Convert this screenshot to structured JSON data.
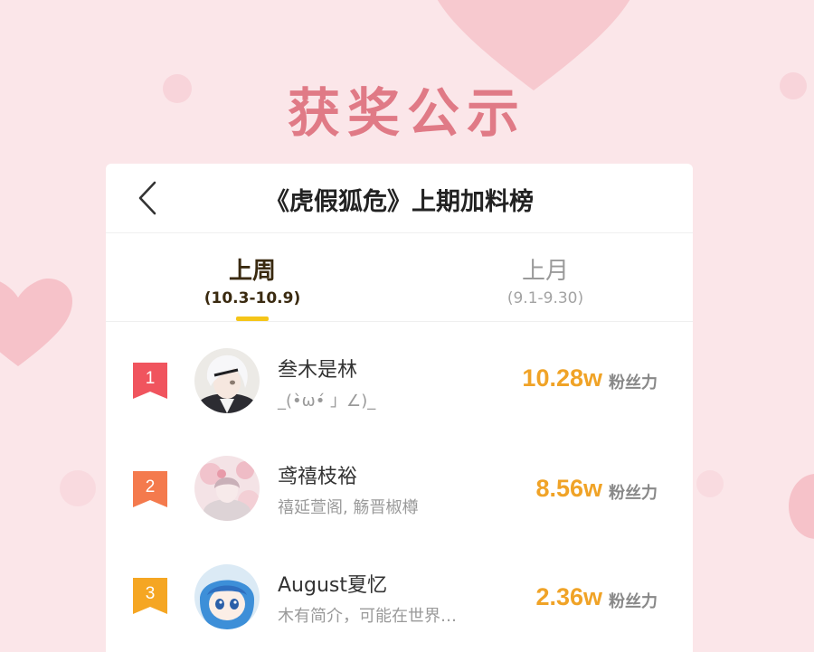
{
  "banner": {
    "title": "获奖公示"
  },
  "header": {
    "back_icon": "chevron-left-icon",
    "title": "《虎假狐危》上期加料榜"
  },
  "tabs": [
    {
      "label": "上周",
      "range": "(10.3-10.9)",
      "active": true
    },
    {
      "label": "上月",
      "range": "(9.1-9.30)",
      "active": false
    }
  ],
  "colors": {
    "background": "#fbe6e9",
    "banner_title": "#e07a86",
    "active_tab_indicator": "#f5c518",
    "score": "#f0a327",
    "rank_1": "#f0545e",
    "rank_2": "#f47a4d",
    "rank_3": "#f5a623"
  },
  "leaderboard": [
    {
      "rank": "1",
      "name": "叁木是林",
      "bio": "_(•̀ω•́ 」∠)_",
      "score": "10.28w",
      "unit": "粉丝力",
      "avatar": "avatar-white-hair-boy"
    },
    {
      "rank": "2",
      "name": "鸢禧枝裕",
      "bio": "禧延萱阁, 觞晋椒樽",
      "score": "8.56w",
      "unit": "粉丝力",
      "avatar": "avatar-pink-blossom-girl"
    },
    {
      "rank": "3",
      "name": "August夏忆",
      "bio": "木有简介，可能在世界…",
      "score": "2.36w",
      "unit": "粉丝力",
      "avatar": "avatar-blue-hair-chibi"
    }
  ]
}
